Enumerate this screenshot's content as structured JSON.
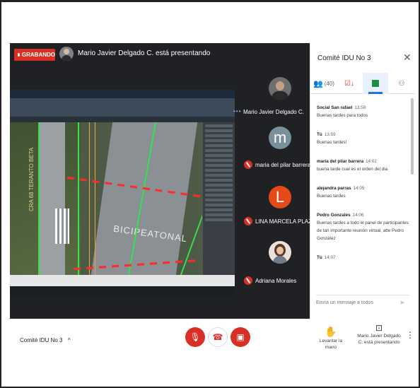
{
  "header": {
    "recording_label": "GRABANDO",
    "presenting_text": "Mario Javier Delgado C. está presentando"
  },
  "shared_screen": {
    "street_label": "CRA 68 TERANTO BETA",
    "area_label": "BICIPEATONAL"
  },
  "tiles": [
    {
      "name": "Mario Javier Delgado C.",
      "avatar_type": "photo",
      "muted": false,
      "speaking_indicator": "•••"
    },
    {
      "name": "maria del pilar barrera",
      "avatar_letter": "m",
      "avatar_color": "#78909c",
      "muted": true
    },
    {
      "name": "LINA MARCELA PLAZAS ACEV...",
      "avatar_letter": "L",
      "avatar_color": "#e64a19",
      "muted": true
    },
    {
      "name": "Adriana Morales",
      "avatar_type": "photo",
      "muted": true
    }
  ],
  "side_panel": {
    "title": "Comité IDU No 3",
    "close_icon": "close-icon",
    "participants_count": "(40)",
    "tabs": [
      {
        "icon": "people-icon",
        "label": "(40)"
      },
      {
        "icon": "activity-icon",
        "label": ""
      },
      {
        "icon": "chat-icon",
        "label": ""
      },
      {
        "icon": "shapes-icon",
        "label": ""
      }
    ],
    "messages": [
      {
        "sender": "Social San rafael",
        "time": "13:58",
        "text": "Buenas tardes para todos"
      },
      {
        "sender": "Tú",
        "time": "13:59",
        "text": "Buenas tardes!"
      },
      {
        "sender": "maria del pilar barrera",
        "time": "14:02",
        "text": "buena tarde cual es el orden del dia"
      },
      {
        "sender": "alejandra parras",
        "time": "14:05",
        "text": "Buenas tardes"
      },
      {
        "sender": "Pedro Gonzales",
        "time": "14:06",
        "text": "Buenas tardes a todo el panel de participantes de tan importante reunión virtual, atte Pedro González"
      },
      {
        "sender": "Tú",
        "time": "14:07",
        "text": ""
      }
    ],
    "compose_placeholder": "Envía un mensaje a todos"
  },
  "bottom_bar": {
    "meeting_name": "Comité IDU No 3",
    "raise_hand_label": "Levantar la mano",
    "present_label": "Mario Javier Delgado C. está presentando"
  },
  "colors": {
    "accent": "#1a73e8",
    "danger": "#d93025",
    "stage_bg": "#202124"
  }
}
